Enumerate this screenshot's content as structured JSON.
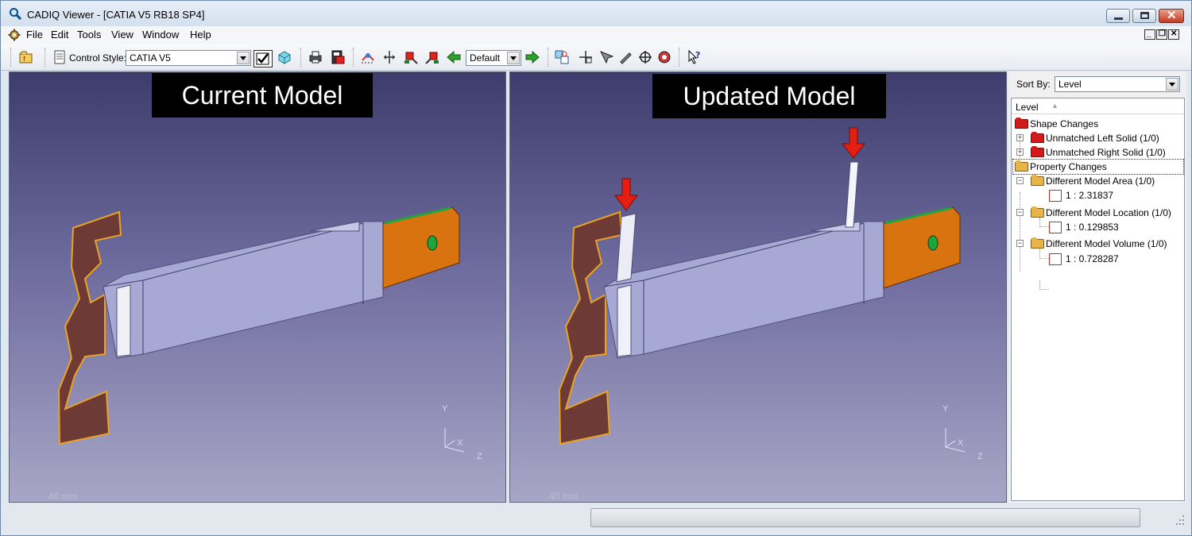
{
  "window": {
    "title": "CADIQ Viewer - [CATIA V5 RB18 SP4]"
  },
  "menubar": {
    "items": [
      "File",
      "Edit",
      "Tools",
      "View",
      "Window",
      "Help"
    ]
  },
  "toolbar": {
    "control_style_label": "Control Style:",
    "control_style_value": "CATIA V5",
    "view_combo_value": "Default"
  },
  "viewports": {
    "left": {
      "label": "Current Model",
      "scale": "40 mm"
    },
    "right": {
      "label": "Updated Model",
      "scale": "40 mm"
    },
    "axis": {
      "y": "Y",
      "x": "X",
      "z": "Z"
    }
  },
  "tree_panel": {
    "sort_by_label": "Sort By:",
    "sort_by_value": "Level",
    "column_header": "Level",
    "nodes": {
      "shape_changes": "Shape Changes",
      "unmatched_left": "Unmatched Left Solid (1/0)",
      "unmatched_right": "Unmatched Right Solid (1/0)",
      "property_changes": "Property Changes",
      "diff_area": "Different Model Area (1/0)",
      "diff_area_value": "1 : 2.31837",
      "diff_location": "Different Model Location (1/0)",
      "diff_location_value": "1 : 0.129853",
      "diff_volume": "Different Model Volume (1/0)",
      "diff_volume_value": "1 : 0.728287"
    }
  },
  "colors": {
    "highlight_arrow": "#e41e12",
    "part_orange": "#d9730f",
    "part_brown": "#6e3a36",
    "part_body": "#a7a8d4",
    "viewport_top": "#3d3c6c",
    "viewport_bottom": "#a7a6c6"
  }
}
